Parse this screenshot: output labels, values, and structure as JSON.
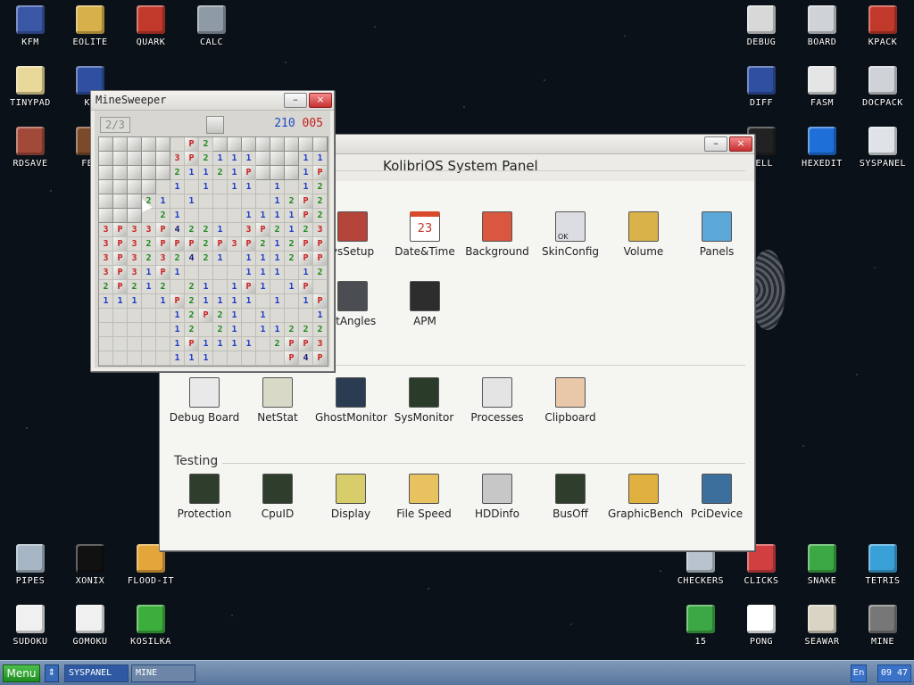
{
  "desktop": {
    "icons": [
      {
        "label": "KFM",
        "icon": "floppy-icon",
        "col": "#3a57a6"
      },
      {
        "label": "EOLITE",
        "icon": "folder-icon",
        "col": "#d8b04a"
      },
      {
        "label": "QUARK",
        "icon": "notebook-icon",
        "col": "#c0392b"
      },
      {
        "label": "CALC",
        "icon": "calculator-icon",
        "col": "#8e9aa6"
      },
      {
        "label": "TINYPAD",
        "icon": "notepad-icon",
        "col": "#e8d89a"
      },
      {
        "label": "KF",
        "icon": "app-icon",
        "col": "#2f4fa0"
      },
      {
        "label": "RDSAVE",
        "icon": "ramdisk-icon",
        "col": "#a24a3a"
      },
      {
        "label": "FB2",
        "icon": "book-icon",
        "col": "#7b4a2a"
      },
      {
        "label": "DEBUG",
        "icon": "bug-icon",
        "col": "#d8d8d8"
      },
      {
        "label": "BOARD",
        "icon": "board-icon",
        "col": "#cfd2d6"
      },
      {
        "label": "KPACK",
        "icon": "hammer-icon",
        "col": "#c0392b"
      },
      {
        "label": "DIFF",
        "icon": "diff-icon",
        "col": "#2f4fa0"
      },
      {
        "label": "FASM",
        "icon": "fasm-icon",
        "col": "#e5e5e5"
      },
      {
        "label": "DOCPACK",
        "icon": "cabinet-icon",
        "col": "#cfd2d6"
      },
      {
        "label": "HELL",
        "icon": "shell-icon",
        "col": "#222"
      },
      {
        "label": "HEXEDIT",
        "icon": "he-icon",
        "col": "#1e6fd8"
      },
      {
        "label": "SYSPANEL",
        "icon": "sliders-icon",
        "col": "#dfe3e7"
      },
      {
        "label": "PIPES",
        "icon": "pipes-icon",
        "col": "#a7b6c4"
      },
      {
        "label": "XONIX",
        "icon": "xonix-icon",
        "col": "#111"
      },
      {
        "label": "FLOOD-IT",
        "icon": "flood-icon",
        "col": "#e4a53b"
      },
      {
        "label": "SUDOKU",
        "icon": "sudoku-icon",
        "col": "#f0f0f0"
      },
      {
        "label": "GOMOKU",
        "icon": "gomoku-icon",
        "col": "#f0f0f0"
      },
      {
        "label": "KOSILKA",
        "icon": "mower-icon",
        "col": "#3cae3c"
      },
      {
        "label": "CHECKERS",
        "icon": "checkers-icon",
        "col": "#b8c3ce"
      },
      {
        "label": "CLICKS",
        "icon": "clicks-icon",
        "col": "#d04040"
      },
      {
        "label": "SNAKE",
        "icon": "snake-icon",
        "col": "#3ca845"
      },
      {
        "label": "TETRIS",
        "icon": "tetris-icon",
        "col": "#3aa0d8"
      },
      {
        "label": "15",
        "icon": "fifteen-icon",
        "col": "#3ca845"
      },
      {
        "label": "PONG",
        "icon": "pong-icon",
        "col": "#ffffff"
      },
      {
        "label": "SEAWAR",
        "icon": "ship-icon",
        "col": "#d9d4c4"
      },
      {
        "label": "MINE",
        "icon": "mine-icon",
        "col": "#777"
      }
    ]
  },
  "syspanel": {
    "title": "KolibriOS System Panel",
    "minimize": "–",
    "close": "×",
    "rows": [
      [
        {
          "label": "ysSetup",
          "icon": "tools-icon"
        },
        {
          "label": "Date&Time",
          "icon": "calendar-icon",
          "day": "23"
        },
        {
          "label": "Background",
          "icon": "monitor-icon"
        },
        {
          "label": "SkinConfig",
          "icon": "skin-icon",
          "text": "OK"
        },
        {
          "label": "Volume",
          "icon": "speaker-icon"
        },
        {
          "label": "Panels",
          "icon": "panels-icon"
        }
      ],
      [
        {
          "label": "otAngles",
          "icon": "screen-icon"
        },
        {
          "label": "APM",
          "icon": "battery-icon"
        }
      ]
    ],
    "row2": [
      {
        "label": "Debug Board",
        "icon": "debug-board-icon"
      },
      {
        "label": "NetStat",
        "icon": "network-icon"
      },
      {
        "label": "GhostMonitor",
        "icon": "ghost-monitor-icon"
      },
      {
        "label": "SysMonitor",
        "icon": "sysmonitor-icon"
      },
      {
        "label": "Processes",
        "icon": "processes-icon"
      },
      {
        "label": "Clipboard",
        "icon": "clipboard-icon"
      }
    ],
    "testing_label": "Testing",
    "testing": [
      {
        "label": "Protection",
        "icon": "chip-icon"
      },
      {
        "label": "CpuID",
        "icon": "chip-icon"
      },
      {
        "label": "Display",
        "icon": "display-icon"
      },
      {
        "label": "File Speed",
        "icon": "folder-icon"
      },
      {
        "label": "HDDinfo",
        "icon": "hdd-icon"
      },
      {
        "label": "BusOff",
        "icon": "chip-icon"
      },
      {
        "label": "GraphicBench",
        "icon": "gauge-icon"
      },
      {
        "label": "PciDevice",
        "icon": "pci-icon"
      }
    ]
  },
  "minesweeper": {
    "title": "MineSweeper",
    "minimize": "–",
    "close": "×",
    "flags": "2/3",
    "time_a": "210",
    "time_b": "005",
    "rows": [
      "#####.P2########",
      "#####3P2111###11",
      "#####21121P###1P",
      "####.1.1.11.1.122",
      "###21.1.....12P21",
      "###.21....1111P21",
      "3P33P4221.3P2123P",
      "3P32PPP2P3P212PP",
      "3P3232421.1112PP3",
      "3P31P1....111.1221",
      "2P212.21.1P1.1P.1",
      "111.1P21111.1.1P1",
      ".....12P21.1...111",
      ".....12.21.1122221",
      ".....1P1111.2PP3P",
      ".....111.....P4P2"
    ]
  },
  "taskbar": {
    "menu": "Menu",
    "arrows": "⇕",
    "tasks": [
      "SYSPANEL",
      "MINE"
    ],
    "lang": "En",
    "clock": "09 47"
  }
}
